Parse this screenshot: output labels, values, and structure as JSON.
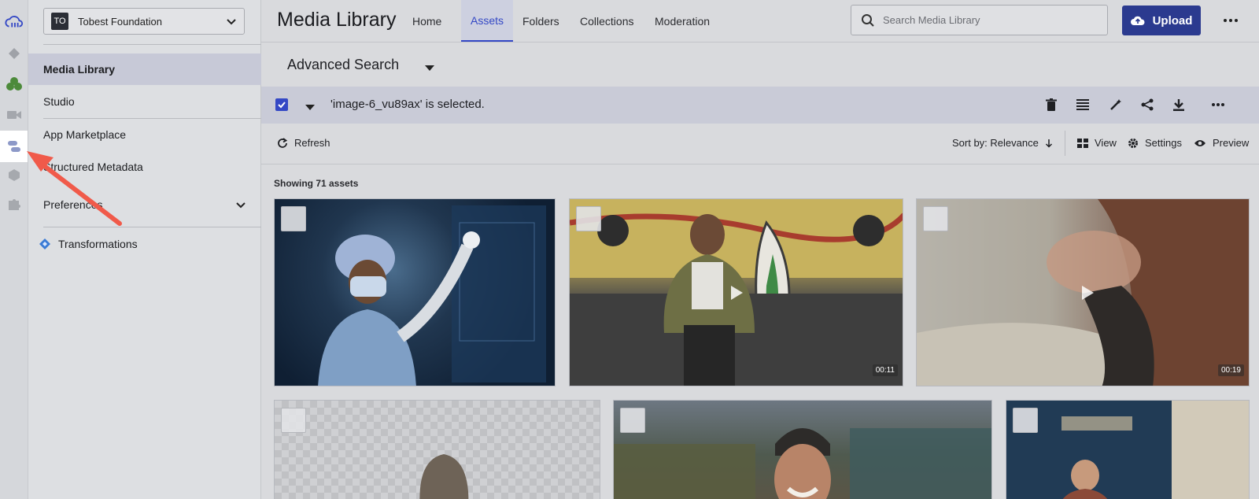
{
  "org": {
    "badge": "TO",
    "name": "Tobest Foundation"
  },
  "sidebar": {
    "items": [
      {
        "label": "Media Library"
      },
      {
        "label": "Studio"
      },
      {
        "label": "App Marketplace"
      },
      {
        "label": "Structured Metadata"
      },
      {
        "label": "Preferences"
      },
      {
        "label": "Transformations"
      }
    ]
  },
  "header": {
    "title": "Media Library",
    "tabs": [
      {
        "label": "Home"
      },
      {
        "label": "Assets"
      },
      {
        "label": "Folders"
      },
      {
        "label": "Collections"
      },
      {
        "label": "Moderation"
      }
    ],
    "search_placeholder": "Search Media Library",
    "upload_label": "Upload"
  },
  "advanced_search": {
    "label": "Advanced Search"
  },
  "selection": {
    "text": "'image-6_vu89ax' is selected."
  },
  "toolbar": {
    "refresh": "Refresh",
    "sort": "Sort by: Relevance",
    "view": "View",
    "settings": "Settings",
    "preview": "Preview"
  },
  "assets": {
    "count_text": "Showing 71 assets",
    "durations": [
      "00:11",
      "00:19"
    ]
  },
  "colors": {
    "accent": "#3448c5",
    "upload_bg": "#2b3a8f",
    "annotation_arrow": "#f05a4a"
  }
}
